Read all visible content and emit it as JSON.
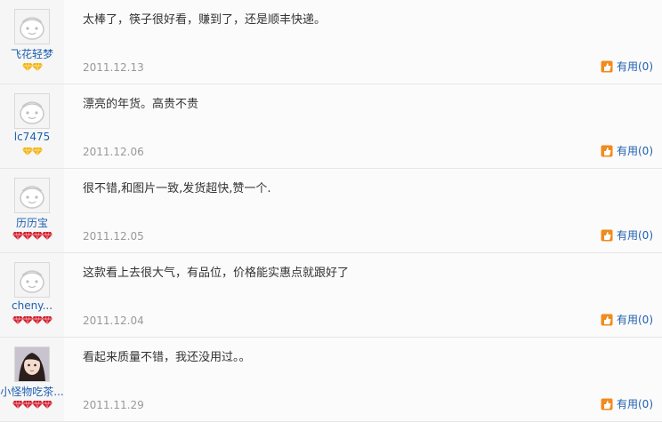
{
  "colors": {
    "link": "#1f5fb0",
    "date": "#999999",
    "text": "#333333",
    "badge_gold": "#f2b20c",
    "badge_red": "#d11b2b",
    "useful_icon": "#f08b1d"
  },
  "useful_label": "有用",
  "reviews": [
    {
      "username": "飞花轻梦",
      "avatar_icon": "default-face-icon",
      "badge_type": "gold",
      "badge_count": 2,
      "text": "太棒了，筷子很好看，赚到了，还是顺丰快递。",
      "date": "2011.12.13",
      "useful_count": "(0)"
    },
    {
      "username": "lc7475",
      "avatar_icon": "default-face-icon",
      "badge_type": "gold",
      "badge_count": 2,
      "text": "漂亮的年货。高贵不贵",
      "date": "2011.12.06",
      "useful_count": "(0)"
    },
    {
      "username": "历历宝",
      "avatar_icon": "default-face-icon",
      "badge_type": "red",
      "badge_count": 4,
      "text": "很不错,和图片一致,发货超快,赞一个.",
      "date": "2011.12.05",
      "useful_count": "(0)"
    },
    {
      "username": "cheny...",
      "avatar_icon": "default-face-icon",
      "badge_type": "red",
      "badge_count": 4,
      "text": "这款看上去很大气，有品位，价格能实惠点就跟好了",
      "date": "2011.12.04",
      "useful_count": "(0)"
    },
    {
      "username": "小怪物吃茶...",
      "avatar_icon": "user-photo-icon",
      "badge_type": "red",
      "badge_count": 4,
      "text": "看起来质量不错，我还没用过。。",
      "date": "2011.11.29",
      "useful_count": "(0)"
    }
  ]
}
